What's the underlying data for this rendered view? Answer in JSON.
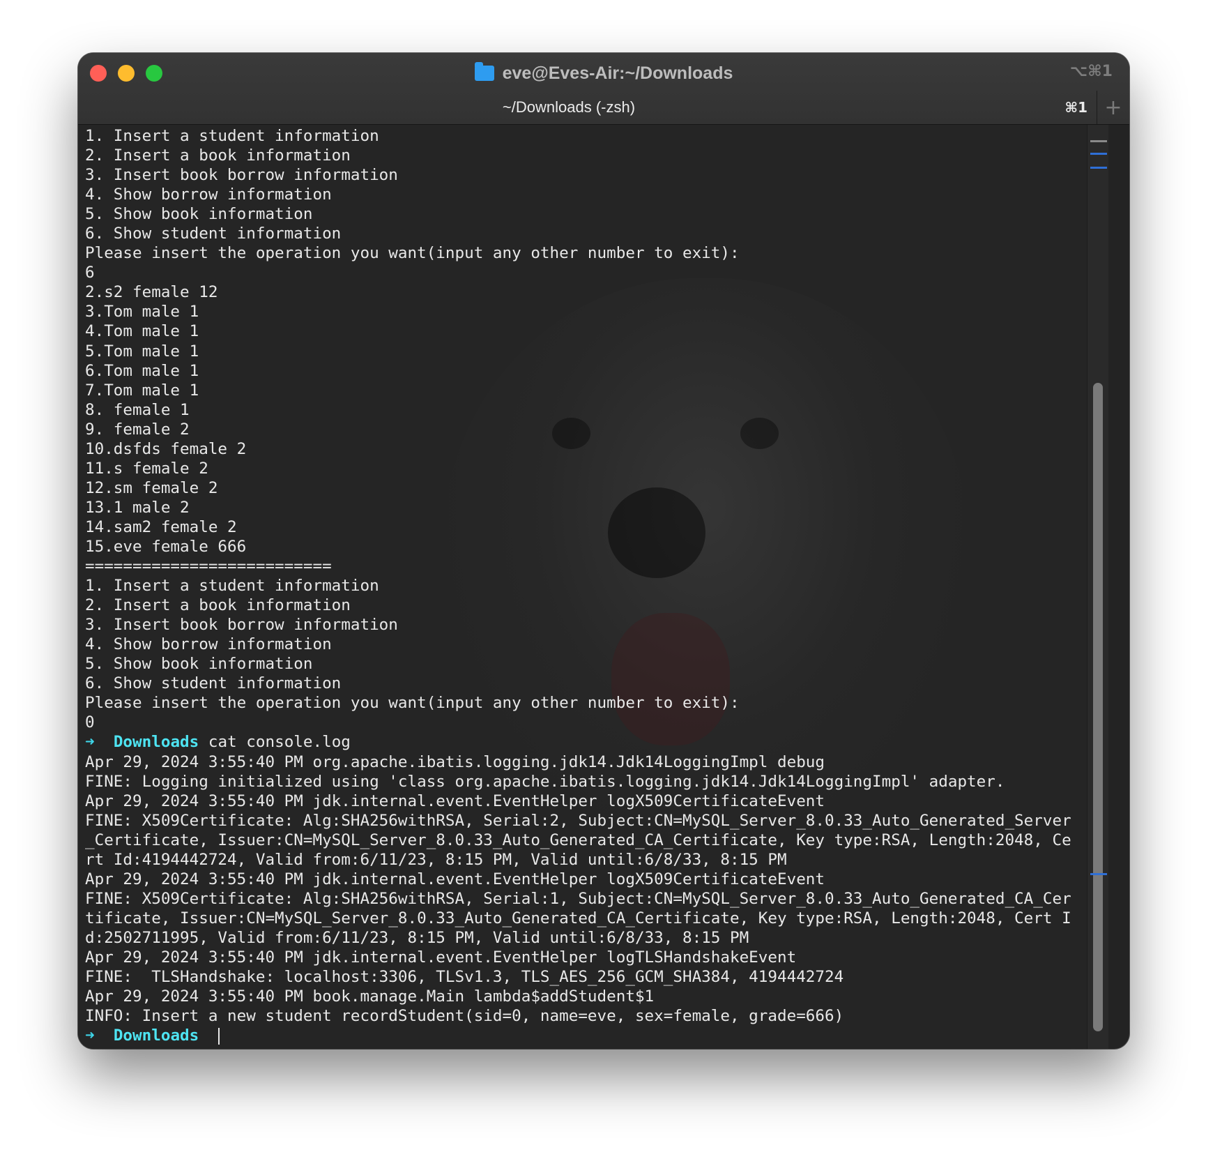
{
  "window": {
    "title": "eve@Eves-Air:~/Downloads",
    "title_shortcut": "⌥⌘1",
    "tab_label": "~/Downloads (-zsh)",
    "tab_shortcut": "⌘1",
    "new_tab_symbol": "+"
  },
  "colors": {
    "prompt": "#4ee4f2",
    "text": "#e8e8e8",
    "background": "#252525",
    "folder_icon": "#2e9cf0"
  },
  "terminal": {
    "lines": [
      {
        "text": "1. Insert a student information"
      },
      {
        "text": "2. Insert a book information"
      },
      {
        "text": "3. Insert book borrow information"
      },
      {
        "text": "4. Show borrow information"
      },
      {
        "text": "5. Show book information"
      },
      {
        "text": "6. Show student information"
      },
      {
        "text": "Please insert the operation you want(input any other number to exit):"
      },
      {
        "text": "6"
      },
      {
        "text": "2.s2 female 12"
      },
      {
        "text": "3.Tom male 1"
      },
      {
        "text": "4.Tom male 1"
      },
      {
        "text": "5.Tom male 1"
      },
      {
        "text": "6.Tom male 1"
      },
      {
        "text": "7.Tom male 1"
      },
      {
        "text": "8. female 1"
      },
      {
        "text": "9. female 2"
      },
      {
        "text": "10.dsfds female 2"
      },
      {
        "text": "11.s female 2"
      },
      {
        "text": "12.sm female 2"
      },
      {
        "text": "13.1 male 2"
      },
      {
        "text": "14.sam2 female 2"
      },
      {
        "text": "15.eve female 666"
      },
      {
        "text": "=========================="
      },
      {
        "text": "1. Insert a student information"
      },
      {
        "text": "2. Insert a book information"
      },
      {
        "text": "3. Insert book borrow information"
      },
      {
        "text": "4. Show borrow information"
      },
      {
        "text": "5. Show book information"
      },
      {
        "text": "6. Show student information"
      },
      {
        "text": "Please insert the operation you want(input any other number to exit):"
      },
      {
        "text": "0"
      },
      {
        "prompt": true,
        "arrow": "➜",
        "dir": "Downloads",
        "text": " cat console.log"
      },
      {
        "text": "Apr 29, 2024 3:55:40 PM org.apache.ibatis.logging.jdk14.Jdk14LoggingImpl debug"
      },
      {
        "text": "FINE: Logging initialized using 'class org.apache.ibatis.logging.jdk14.Jdk14LoggingImpl' adapter."
      },
      {
        "text": "Apr 29, 2024 3:55:40 PM jdk.internal.event.EventHelper logX509CertificateEvent"
      },
      {
        "text": "FINE: X509Certificate: Alg:SHA256withRSA, Serial:2, Subject:CN=MySQL_Server_8.0.33_Auto_Generated_Server"
      },
      {
        "text": "_Certificate, Issuer:CN=MySQL_Server_8.0.33_Auto_Generated_CA_Certificate, Key type:RSA, Length:2048, Ce"
      },
      {
        "text": "rt Id:4194442724, Valid from:6/11/23, 8:15 PM, Valid until:6/8/33, 8:15 PM"
      },
      {
        "text": "Apr 29, 2024 3:55:40 PM jdk.internal.event.EventHelper logX509CertificateEvent"
      },
      {
        "text": "FINE: X509Certificate: Alg:SHA256withRSA, Serial:1, Subject:CN=MySQL_Server_8.0.33_Auto_Generated_CA_Cer"
      },
      {
        "text": "tificate, Issuer:CN=MySQL_Server_8.0.33_Auto_Generated_CA_Certificate, Key type:RSA, Length:2048, Cert I"
      },
      {
        "text": "d:2502711995, Valid from:6/11/23, 8:15 PM, Valid until:6/8/33, 8:15 PM"
      },
      {
        "text": "Apr 29, 2024 3:55:40 PM jdk.internal.event.EventHelper logTLSHandshakeEvent"
      },
      {
        "text": "FINE:  TLSHandshake: localhost:3306, TLSv1.3, TLS_AES_256_GCM_SHA384, 4194442724"
      },
      {
        "text": "Apr 29, 2024 3:55:40 PM book.manage.Main lambda$addStudent$1"
      },
      {
        "text": "INFO: Insert a new student recordStudent(sid=0, name=eve, sex=female, grade=666)"
      },
      {
        "prompt": true,
        "arrow": "➜",
        "dir": "Downloads",
        "text": " ",
        "cursor": true
      }
    ]
  }
}
